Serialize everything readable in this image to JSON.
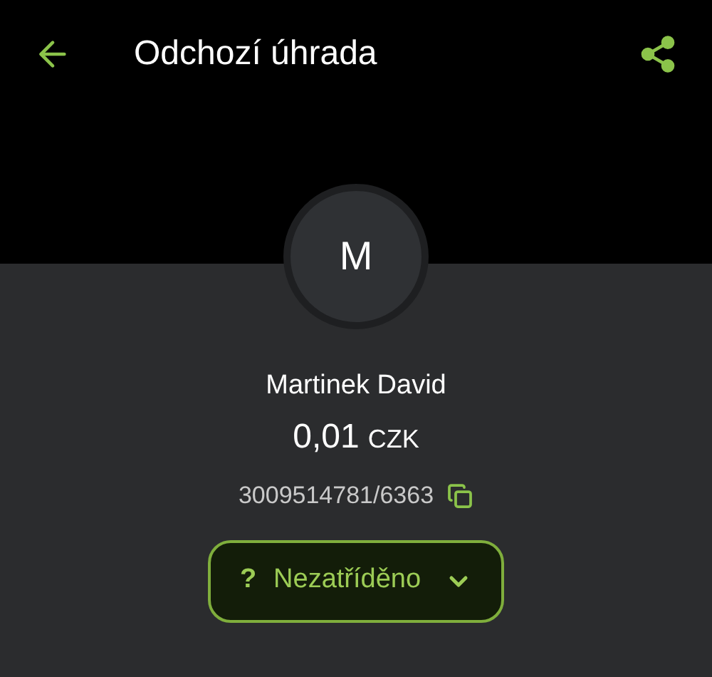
{
  "top_bar": {
    "title": "Odchozí úhrada"
  },
  "counterparty": {
    "initial": "M",
    "name": "Martinek David",
    "amount": "0,01",
    "currency": "CZK",
    "account": "3009514781/6363"
  },
  "category_button": {
    "symbol": "?",
    "label": "Nezatříděno"
  }
}
